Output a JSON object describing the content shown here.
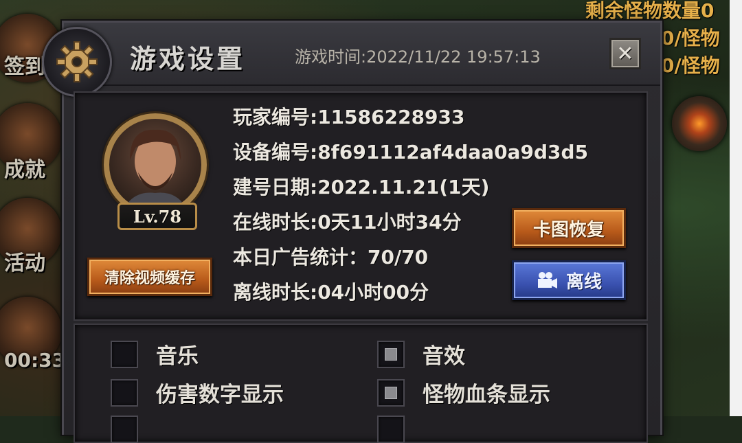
{
  "background": {
    "hud_remaining_monsters": "剩余怪物数量0",
    "hud_line2": "0/怪物",
    "hud_line3": "0/怪物",
    "left_menu": [
      {
        "label": "签到"
      },
      {
        "label": "成就"
      },
      {
        "label": "活动"
      },
      {
        "label": "00:33"
      }
    ]
  },
  "dialog": {
    "title": "游戏设置",
    "game_time": "游戏时间:2022/11/22 19:57:13",
    "close_label": "✕",
    "gear_icon": "gear-icon"
  },
  "player": {
    "level": "Lv.78",
    "info": [
      "玩家编号:11586228933",
      "设备编号:8f691112af4daa0a9d3d5",
      "建号日期:2022.11.21(1天)",
      "在线时长:0天11小时34分",
      "本日广告统计：70/70",
      "离线时长:04小时00分"
    ]
  },
  "buttons": {
    "clear_cache": "清除视频缓存",
    "map_recover": "卡图恢复",
    "offline": "离线",
    "offline_icon": "video-camera-icon"
  },
  "options": [
    {
      "label": "音乐",
      "checked": false
    },
    {
      "label": "音效",
      "checked": true
    },
    {
      "label": "伤害数字显示",
      "checked": false
    },
    {
      "label": "怪物血条显示",
      "checked": true
    }
  ],
  "colors": {
    "orange_button": "#b85a1a",
    "blue_button": "#3a52b0",
    "hud_gold": "#e6b04a"
  }
}
